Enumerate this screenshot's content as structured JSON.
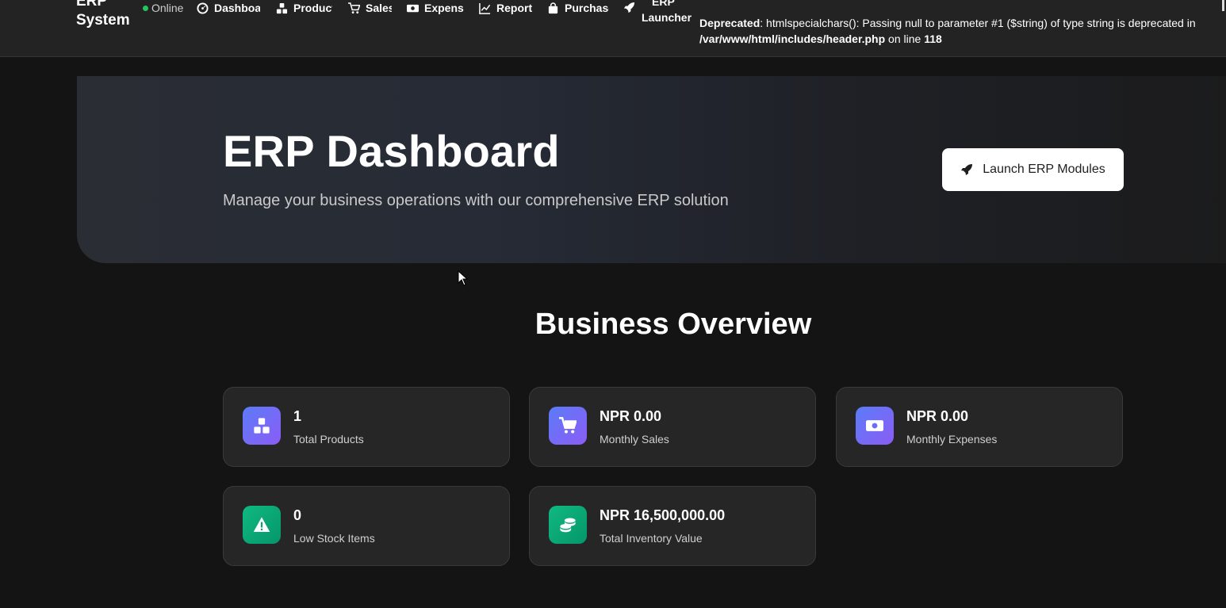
{
  "header": {
    "brand_line1": "ERP",
    "brand_line2": "System",
    "status": "Online",
    "status_color": "#22c55e",
    "nav": [
      {
        "label": "Dashboard",
        "icon": "gauge-icon"
      },
      {
        "label": "Products",
        "icon": "boxes-icon"
      },
      {
        "label": "Sales",
        "icon": "cart-icon"
      },
      {
        "label": "Expenses",
        "icon": "money-icon"
      },
      {
        "label": "Report",
        "icon": "chart-line-icon"
      },
      {
        "label": "Purchase",
        "icon": "bag-icon"
      }
    ],
    "launcher_line1": "ERP",
    "launcher_line2": "Launcher",
    "warning": {
      "label": "Deprecated",
      "message": ": htmlspecialchars(): Passing null to parameter #1 ($string) of type string is deprecated in",
      "path": "/var/www/html/includes/header.php",
      "on_line": " on line ",
      "line": "118"
    }
  },
  "hero": {
    "title": "ERP Dashboard",
    "subtitle": "Manage your business operations with our comprehensive ERP solution",
    "button_label": "Launch ERP Modules"
  },
  "overview": {
    "title": "Business Overview",
    "cards": [
      {
        "value": "1",
        "label": "Total Products",
        "icon": "boxes-icon",
        "color": "purple"
      },
      {
        "value": "NPR 0.00",
        "label": "Monthly Sales",
        "icon": "cart-icon",
        "color": "purple"
      },
      {
        "value": "NPR 0.00",
        "label": "Monthly Expenses",
        "icon": "money-icon",
        "color": "purple"
      },
      {
        "value": "0",
        "label": "Low Stock Items",
        "icon": "warning-icon",
        "color": "green"
      },
      {
        "value": "NPR 16,500,000.00",
        "label": "Total Inventory Value",
        "icon": "coins-icon",
        "color": "green"
      }
    ]
  },
  "colors": {
    "background": "#141414",
    "card": "#262626",
    "accent_purple": "#6c6cf5",
    "accent_green": "#10b981"
  }
}
